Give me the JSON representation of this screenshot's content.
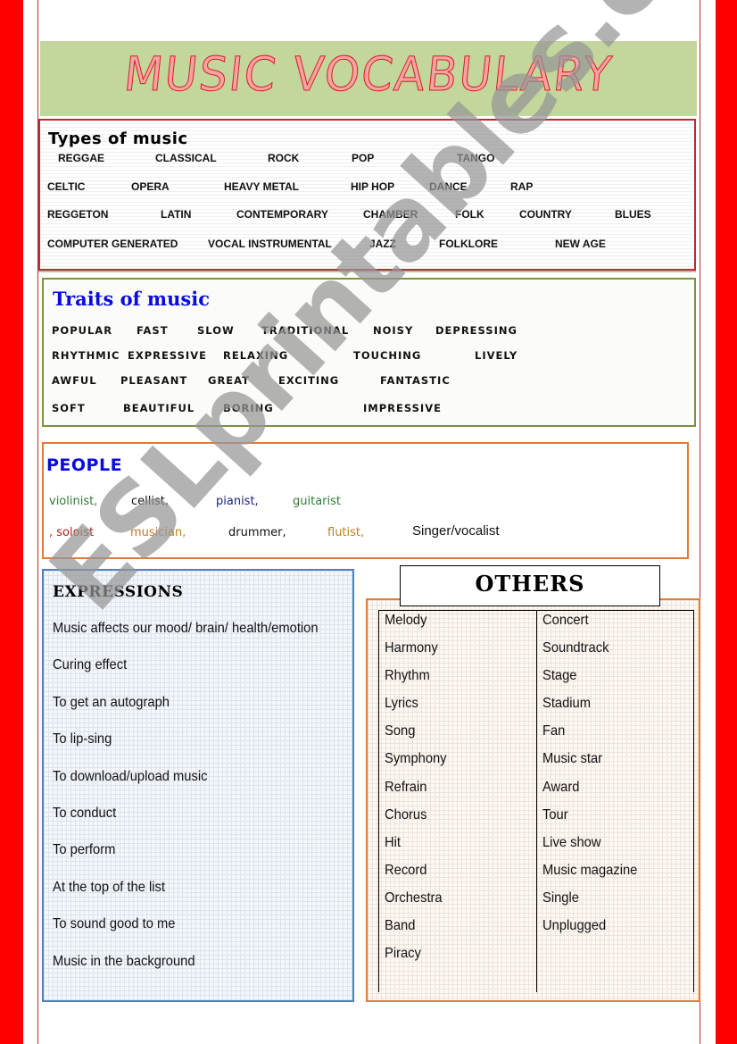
{
  "title": "MUSIC VOCABULARY",
  "types_of_music": {
    "heading": "Types of music",
    "rows": [
      [
        "REGGAE",
        "CLASSICAL",
        "ROCK",
        "POP",
        "TANGO"
      ],
      [
        "CELTIC",
        "OPERA",
        "HEAVY METAL",
        "HIP HOP",
        "DANCE",
        "RAP"
      ],
      [
        "REGGETON",
        "LATIN",
        "CONTEMPORARY",
        "CHAMBER",
        "FOLK",
        "COUNTRY",
        "BLUES"
      ],
      [
        "COMPUTER GENERATED",
        "VOCAL INSTRUMENTAL",
        "JAZZ",
        "FOLKLORE",
        "NEW AGE"
      ]
    ]
  },
  "traits_of_music": {
    "heading": "Traits of music",
    "rows": [
      [
        "POPULAR",
        "FAST",
        "SLOW",
        "TRADITIONAL",
        "NOISY",
        "DEPRESSING"
      ],
      [
        "RHYTHMIC",
        "EXPRESSIVE",
        "RELAXING",
        "TOUCHING",
        "LIVELY"
      ],
      [
        "AWFUL",
        "PLEASANT",
        "GREAT",
        "EXCITING",
        "FANTASTIC"
      ],
      [
        "SOFT",
        "BEAUTIFUL",
        "BORING",
        "IMPRESSIVE"
      ]
    ]
  },
  "people": {
    "heading": "PEOPLE",
    "row1": [
      {
        "text": "violinist,",
        "color": "#2e7d32"
      },
      {
        "text": "cellist,",
        "color": "#111111"
      },
      {
        "text": "pianist,",
        "color": "#1a237e"
      },
      {
        "text": "guitarist",
        "color": "#2e7d32"
      }
    ],
    "row2": [
      {
        "text": ", soloist",
        "color": "#b71c1c"
      },
      {
        "text": "musician,",
        "color": "#c47a1f"
      },
      {
        "text": "drummer,",
        "color": "#111111"
      },
      {
        "text": "flutist,",
        "color": "#c47a1f"
      },
      {
        "text": "Singer/vocalist",
        "color": "#111111"
      }
    ]
  },
  "expressions": {
    "heading": "EXPRESSIONS",
    "items": [
      "Music affects our mood/ brain/ health/emotion",
      "Curing effect",
      "To get an autograph",
      "To lip-sing",
      "To download/upload music",
      "To conduct",
      "To perform",
      "At the top of the list",
      "To sound good to me",
      "Music in the background"
    ]
  },
  "others": {
    "heading": "OTHERS",
    "col1": [
      "Melody",
      "Harmony",
      "Rhythm",
      "Lyrics",
      "Song",
      "Symphony",
      "Refrain",
      "Chorus",
      "Hit",
      "Record",
      "Orchestra",
      "Band",
      "Piracy"
    ],
    "col2": [
      "Concert",
      "Soundtrack",
      "Stage",
      "Stadium",
      "Fan",
      "Music star",
      "Award",
      "Tour",
      "Live show",
      "Music magazine",
      "Single",
      "Unplugged"
    ]
  },
  "watermark": "ESLprintables.com",
  "colors": {
    "side_bar": "#ff0000",
    "title_band": "#c3d69b",
    "types_border": "#c0282d",
    "traits_border": "#77933c",
    "people_border": "#e07b39",
    "expressions_border": "#4f81bd",
    "heading_blue": "#0a0ae0"
  }
}
